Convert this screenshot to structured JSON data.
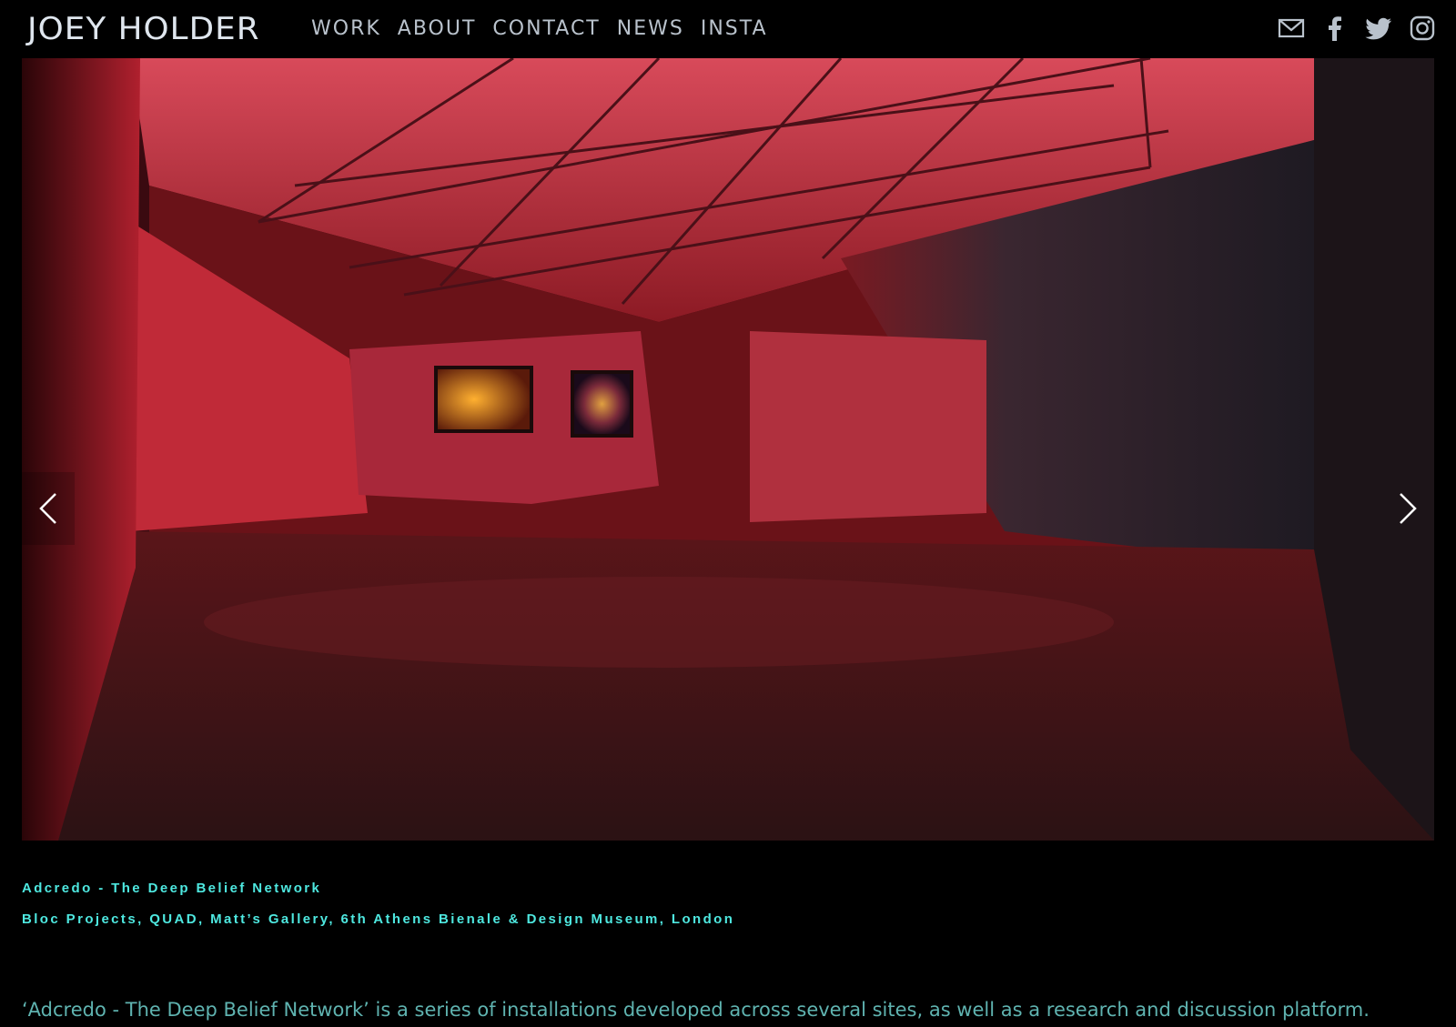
{
  "header": {
    "logo": "JOEY HOLDER",
    "nav": [
      "WORK",
      "ABOUT",
      "CONTACT",
      "NEWS",
      "INSTA"
    ],
    "social_icons": [
      "mail-icon",
      "facebook-icon",
      "twitter-icon",
      "instagram-icon"
    ]
  },
  "slideshow": {
    "prev_icon": "chevron-left-icon",
    "next_icon": "chevron-right-icon"
  },
  "project": {
    "title": "Adcredo - The Deep Belief Network",
    "venues": "Bloc Projects, QUAD, Matt’s Gallery, 6th Athens Bienale & Design Museum, London",
    "description": "‘Adcredo - The Deep Belief Network’ is a series of installations developed across several sites, as well as a research and discussion platform."
  },
  "colors": {
    "background": "#000000",
    "accent": "#4ee8e0",
    "nav_text": "#b9c2cc",
    "description_text": "#5fb3b0"
  }
}
